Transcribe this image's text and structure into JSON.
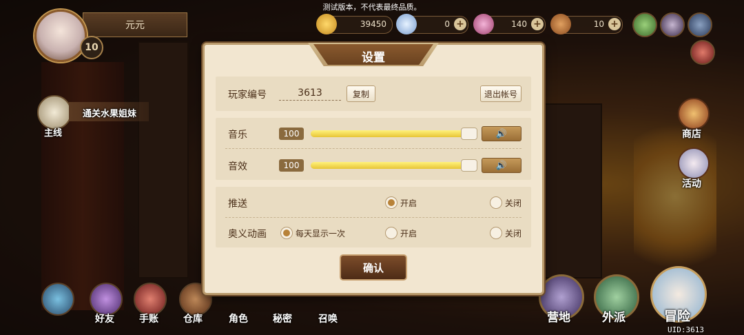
{
  "notice": "测试版本，不代表最终品质。",
  "player": {
    "name": "元元",
    "level": "10"
  },
  "resources": [
    {
      "icon": "gold-coin-icon",
      "value": "39450"
    },
    {
      "icon": "diamond-icon",
      "value": "0"
    },
    {
      "icon": "crystal-icon",
      "value": "140"
    },
    {
      "icon": "bread-icon",
      "value": "10"
    }
  ],
  "quest": {
    "label": "主线",
    "text": "通关水果姐妹"
  },
  "right_menu": {
    "shop": "商店",
    "event": "活动"
  },
  "bottom_menu": [
    "好友",
    "手账",
    "仓库",
    "角色",
    "秘密",
    "召唤"
  ],
  "big_menu": [
    "营地",
    "外派",
    "冒险"
  ],
  "uid": "UID:3613",
  "settings": {
    "title": "设置",
    "player_id_label": "玩家编号",
    "player_id": "3613",
    "copy_label": "复制",
    "logout_label": "退出帐号",
    "music_label": "音乐",
    "music_value": "100",
    "music_level": 1.0,
    "sfx_label": "音效",
    "sfx_value": "100",
    "sfx_level": 1.0,
    "push_label": "推送",
    "push_on": "开启",
    "push_off": "关闭",
    "push_selected": "开启",
    "anim_label": "奥义动画",
    "anim_daily": "每天显示一次",
    "anim_on": "开启",
    "anim_off": "关闭",
    "anim_selected": "每天显示一次",
    "confirm_label": "确认"
  }
}
